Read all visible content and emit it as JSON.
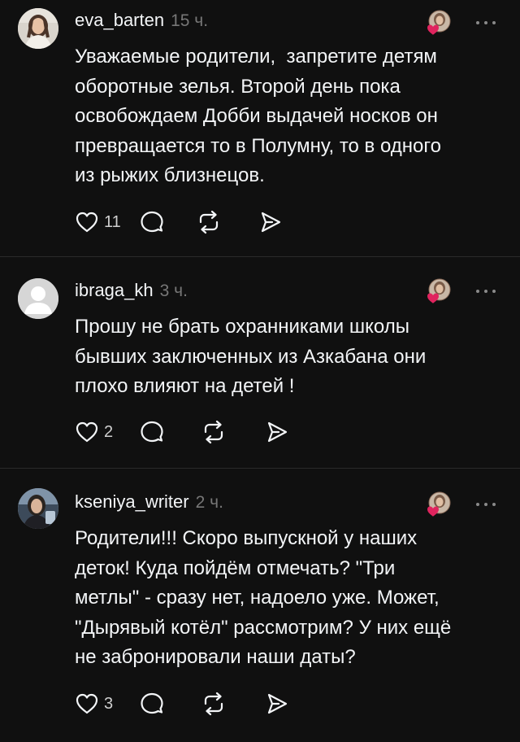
{
  "posts": [
    {
      "username": "eva_barten",
      "time": "15 ч.",
      "text": "Уважаемые родители,  запретите детям\nоборотные зелья. Второй день пока\nосвобождаем Добби выдачей носков он\nпревращается то в Полумну, то в одного\nиз рыжих близнецов.",
      "likes": "11",
      "avatar_icon": "woman-photo-avatar"
    },
    {
      "username": "ibraga_kh",
      "time": "3 ч.",
      "text": "Прошу не брать охранниками школы\nбывших заключенных из Азкабана они\nплохо влияют на детей !",
      "likes": "2",
      "avatar_icon": "default-user-avatar"
    },
    {
      "username": "kseniya_writer",
      "time": "2 ч.",
      "text": "Родители!!! Скоро выпускной у наших\nдеток! Куда пойдём отмечать? \"Три\nметлы\" - сразу нет, надоело уже. Может,\n\"Дырявый котёл\" рассмотрим? У них ещё\nне забронировали наши даты?",
      "likes": "3",
      "avatar_icon": "woman-photo-avatar"
    }
  ],
  "colors": {
    "background": "#101010",
    "text": "#f3f5f7",
    "muted": "#777777",
    "divider": "#2a2a2a",
    "like_heart": "#e0245e"
  },
  "icons": [
    "heart-icon",
    "comment-icon",
    "repost-icon",
    "send-icon",
    "more-icon",
    "reactor-avatar-icon"
  ]
}
